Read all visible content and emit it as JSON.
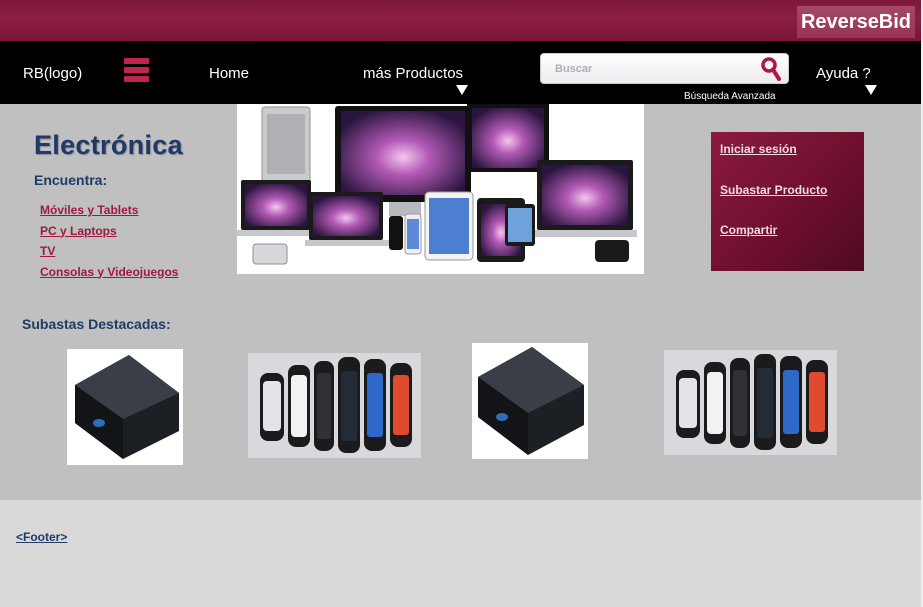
{
  "header": {
    "brand": "ReverseBid"
  },
  "nav": {
    "logo": "RB(logo)",
    "home": "Home",
    "more_products": "más Productos",
    "search_placeholder": "Buscar",
    "advanced_search": "Búsqueda  Avanzada",
    "help": "Ayuda ?"
  },
  "category": {
    "title": "Electrónica",
    "find_label": "Encuentra:",
    "links": [
      "Móviles y  Tablets",
      "PC y  Laptops",
      "TV",
      "Consolas y Videojuegos"
    ]
  },
  "account_panel": {
    "login": "Iniciar sesión",
    "auction_product": "Subastar Producto",
    "share": "Compartir"
  },
  "featured": {
    "title": "Subastas Destacadas:",
    "items": [
      {
        "icon": "black-console-box-image"
      },
      {
        "icon": "smart-bands-image"
      },
      {
        "icon": "black-console-box-image"
      },
      {
        "icon": "smart-bands-image"
      }
    ]
  },
  "footer": {
    "label": "<Footer>"
  },
  "colors": {
    "accent": "#8c1f44",
    "nav_bg": "#000000",
    "content_bg": "#c0c0c0",
    "footer_bg": "#d9d9d9",
    "title_blue": "#1f3a66",
    "link_red": "#a0183d"
  }
}
